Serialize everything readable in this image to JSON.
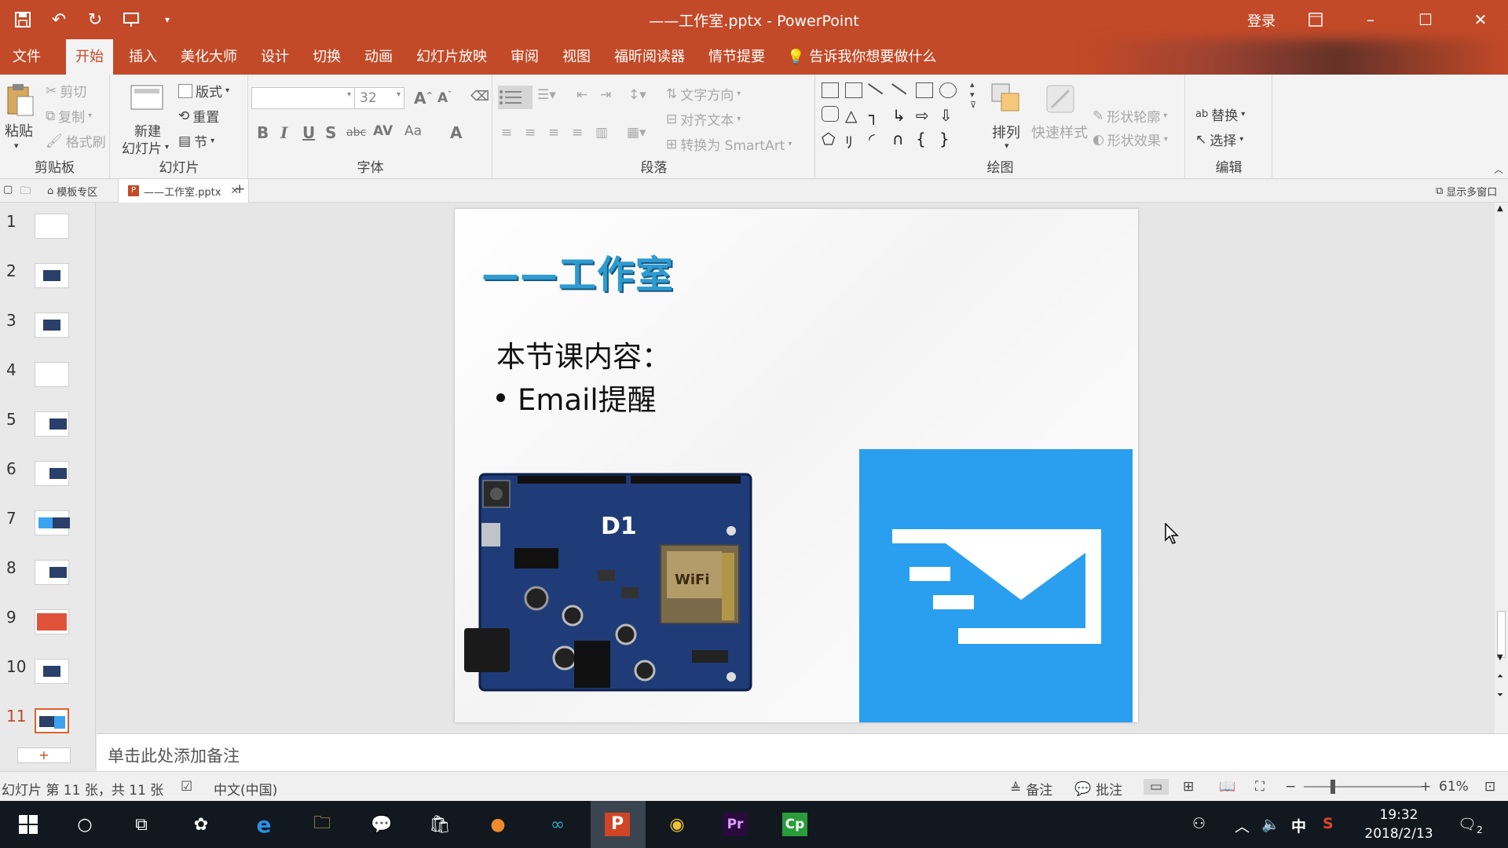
{
  "window": {
    "title": "——工作室.pptx  -  PowerPoint",
    "signin": "登录"
  },
  "tabs": [
    {
      "label": "文件"
    },
    {
      "label": "开始"
    },
    {
      "label": "插入"
    },
    {
      "label": "美化大师"
    },
    {
      "label": "设计"
    },
    {
      "label": "切换"
    },
    {
      "label": "动画"
    },
    {
      "label": "幻灯片放映"
    },
    {
      "label": "审阅"
    },
    {
      "label": "视图"
    },
    {
      "label": "福昕阅读器"
    },
    {
      "label": "情节提要"
    }
  ],
  "tellme": "告诉我你想要做什么",
  "ribbon": {
    "clipboard": {
      "paste": "粘贴",
      "cut": "剪切",
      "copy": "复制",
      "format_painter": "格式刷",
      "label": "剪贴板"
    },
    "slides": {
      "new_slide_1": "新建",
      "new_slide_2": "幻灯片",
      "layout": "版式",
      "reset": "重置",
      "section": "节",
      "label": "幻灯片"
    },
    "font": {
      "size": "32",
      "label": "字体"
    },
    "paragraph": {
      "text_direction": "文字方向",
      "align_text": "对齐文本",
      "convert_smartart": "转换为 SmartArt",
      "label": "段落"
    },
    "drawing": {
      "arrange": "排列",
      "quick_styles": "快速样式",
      "shape_outline": "形状轮廓",
      "shape_effects": "形状效果",
      "label": "绘图"
    },
    "editing": {
      "replace": "替换",
      "select": "选择",
      "label": "编辑"
    }
  },
  "docstrip": {
    "template_zone": "模板专区",
    "doc_tab": "——工作室.pptx",
    "multi_window": "显示多窗口"
  },
  "thumbnails": [
    "1",
    "2",
    "3",
    "4",
    "5",
    "6",
    "7",
    "8",
    "9",
    "10",
    "11"
  ],
  "current_slide_index": 11,
  "slide": {
    "title": "——工作室",
    "subtitle": "本节课内容：",
    "bullet": "Email提醒",
    "board_label": "D1",
    "board_wifi": "WiFi"
  },
  "notes": {
    "placeholder": "单击此处添加备注"
  },
  "status": {
    "slide_info": "幻灯片 第 11 张，共 11 张",
    "language": "中文(中国)",
    "notes": "备注",
    "comments": "批注",
    "zoom": "61%"
  },
  "taskbar": {
    "time": "19:32",
    "date": "2018/2/13",
    "ime": "中",
    "notif_count": "2"
  },
  "colors": {
    "accent": "#c34a28",
    "slide_title": "#2e9bd1",
    "mail_blue": "#2a9ff0"
  }
}
